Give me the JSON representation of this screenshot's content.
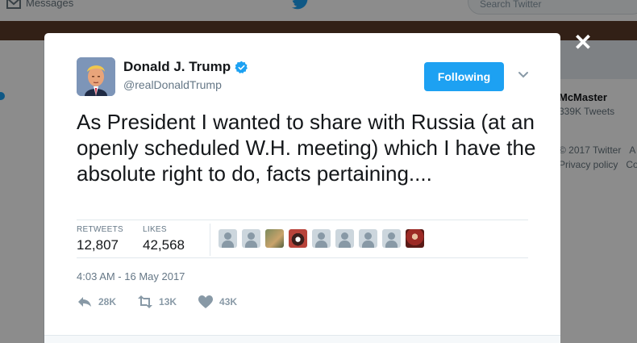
{
  "background": {
    "nav_messages": "Messages",
    "search_placeholder": "Search Twitter",
    "sidebar_name": "McMaster",
    "sidebar_tweets": "339K Tweets",
    "footer_copyright": "© 2017 Twitter",
    "footer_about": "A",
    "footer_privacy": "Privacy policy",
    "footer_cookies": "Co"
  },
  "tweet": {
    "display_name": "Donald J. Trump",
    "handle": "@realDonaldTrump",
    "follow_label": "Following",
    "text": "As President I wanted to share with Russia (at an openly scheduled W.H. meeting) which I have the absolute right to do, facts pertaining....",
    "retweets_label": "RETWEETS",
    "retweets_value": "12,807",
    "likes_label": "LIKES",
    "likes_value": "42,568",
    "timestamp": "4:03 AM - 16 May 2017",
    "reply_count": "28K",
    "retweet_count": "13K",
    "like_count": "43K"
  },
  "colors": {
    "accent": "#1da1f2",
    "text": "#14171a",
    "muted": "#657786"
  },
  "icons": [
    "close-icon",
    "verified-icon",
    "chevron-down-icon",
    "reply-icon",
    "retweet-icon",
    "like-icon"
  ]
}
